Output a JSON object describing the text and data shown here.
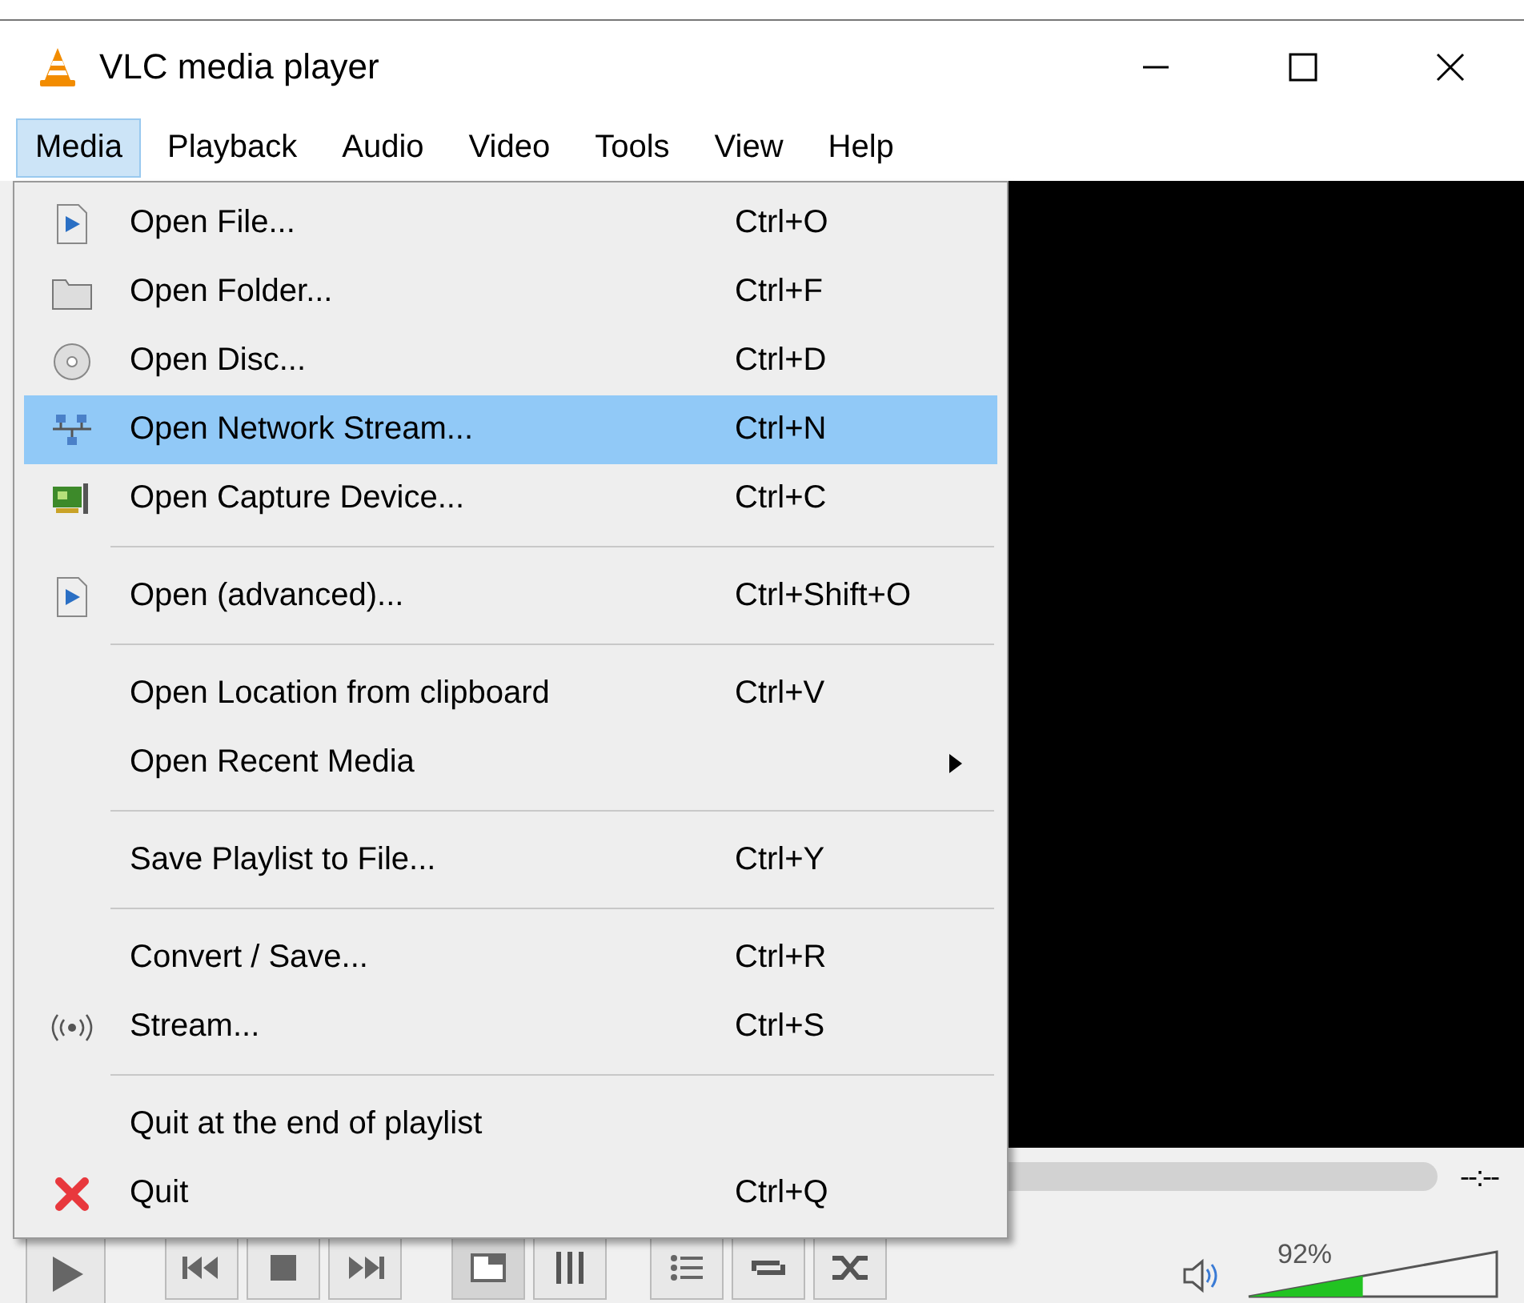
{
  "window": {
    "title": "VLC media player"
  },
  "menubar": [
    {
      "label": "Media",
      "selected": true
    },
    {
      "label": "Playback",
      "selected": false
    },
    {
      "label": "Audio",
      "selected": false
    },
    {
      "label": "Video",
      "selected": false
    },
    {
      "label": "Tools",
      "selected": false
    },
    {
      "label": "View",
      "selected": false
    },
    {
      "label": "Help",
      "selected": false
    }
  ],
  "media_menu": [
    {
      "kind": "item",
      "label": "Open File...",
      "shortcut": "Ctrl+O",
      "selected": false,
      "submenu": false
    },
    {
      "kind": "item",
      "label": "Open Folder...",
      "shortcut": "Ctrl+F",
      "selected": false,
      "submenu": false
    },
    {
      "kind": "item",
      "label": "Open Disc...",
      "shortcut": "Ctrl+D",
      "selected": false,
      "submenu": false
    },
    {
      "kind": "item",
      "label": "Open Network Stream...",
      "shortcut": "Ctrl+N",
      "selected": true,
      "submenu": false
    },
    {
      "kind": "item",
      "label": "Open Capture Device...",
      "shortcut": "Ctrl+C",
      "selected": false,
      "submenu": false
    },
    {
      "kind": "separator"
    },
    {
      "kind": "item",
      "label": "Open (advanced)...",
      "shortcut": "Ctrl+Shift+O",
      "selected": false,
      "submenu": false
    },
    {
      "kind": "separator"
    },
    {
      "kind": "item",
      "label": "Open Location from clipboard",
      "shortcut": "Ctrl+V",
      "selected": false,
      "submenu": false
    },
    {
      "kind": "item",
      "label": "Open Recent Media",
      "selected": false,
      "submenu": true
    },
    {
      "kind": "separator"
    },
    {
      "kind": "item",
      "label": "Save Playlist to File...",
      "shortcut": "Ctrl+Y",
      "selected": false,
      "submenu": false
    },
    {
      "kind": "separator"
    },
    {
      "kind": "item",
      "label": "Convert / Save...",
      "shortcut": "Ctrl+R",
      "selected": false,
      "submenu": false
    },
    {
      "kind": "item",
      "label": "Stream...",
      "shortcut": "Ctrl+S",
      "selected": false,
      "submenu": false
    },
    {
      "kind": "separator"
    },
    {
      "kind": "item",
      "label": "Quit at the end of playlist",
      "selected": false,
      "submenu": false
    },
    {
      "kind": "item",
      "label": "Quit",
      "shortcut": "Ctrl+Q",
      "selected": false,
      "submenu": false
    }
  ],
  "seek": {
    "time": "--:--"
  },
  "volume": {
    "reading": "92%",
    "level": 0.46
  }
}
